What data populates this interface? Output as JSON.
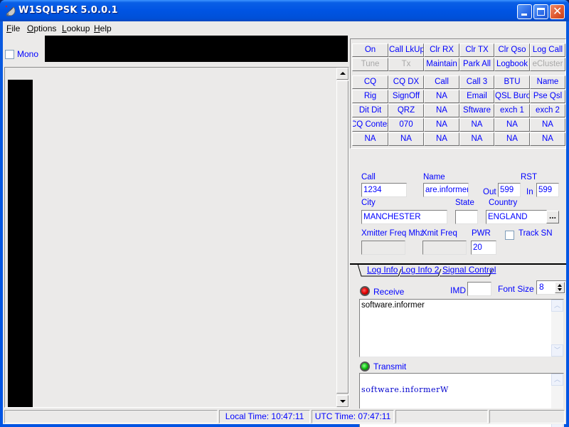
{
  "window": {
    "title": "W1SQLPSK 5.0.0.1",
    "app_icon": "satellite-dish-icon",
    "controls": {
      "minimize": "minimize-icon",
      "maximize": "maximize-icon",
      "close": "close-icon",
      "close_glyph": "✕"
    }
  },
  "menu": {
    "items": [
      {
        "label": "File",
        "accel": "F",
        "rest": "ile"
      },
      {
        "label": "Options",
        "accel": "O",
        "rest": "ptions"
      },
      {
        "label": "Lookup",
        "accel": "L",
        "rest": "ookup"
      },
      {
        "label": "Help",
        "accel": "H",
        "rest": "elp"
      }
    ]
  },
  "left": {
    "mono_label": "Mono",
    "mono_checked": false
  },
  "buttons": {
    "row1": [
      {
        "label": "On",
        "enabled": true
      },
      {
        "label": "Call LkUp",
        "enabled": true
      },
      {
        "label": "Clr RX",
        "enabled": true
      },
      {
        "label": "Clr TX",
        "enabled": true
      },
      {
        "label": "Clr Qso",
        "enabled": true
      },
      {
        "label": "Log Call",
        "enabled": true
      }
    ],
    "row2": [
      {
        "label": "Tune",
        "enabled": false
      },
      {
        "label": "Tx",
        "enabled": false
      },
      {
        "label": "Maintain",
        "enabled": true
      },
      {
        "label": "Park All",
        "enabled": true
      },
      {
        "label": "Logbook",
        "enabled": true
      },
      {
        "label": "eCluster",
        "enabled": false
      }
    ],
    "macros": [
      [
        "CQ",
        "CQ DX",
        "Call",
        "Call 3",
        "BTU",
        "Name"
      ],
      [
        "Rig",
        "SignOff",
        "NA",
        "Email",
        "QSL Buro",
        "Pse Qsl"
      ],
      [
        "Dit Dit",
        "QRZ",
        "NA",
        "Sftware",
        "exch 1",
        "exch 2"
      ],
      [
        "CQ Contes",
        "070",
        "NA",
        "NA",
        "NA",
        "NA"
      ],
      [
        "NA",
        "NA",
        "NA",
        "NA",
        "NA",
        "NA"
      ]
    ]
  },
  "form": {
    "call_label": "Call",
    "call_value": "1234",
    "name_label": "Name",
    "name_value": "are.informer",
    "rst_label": "RST",
    "out_label": "Out",
    "out_value": "599",
    "in_label": "In",
    "in_value": "599",
    "city_label": "City",
    "city_value": "MANCHESTER",
    "state_label": "State",
    "state_value": "",
    "country_label": "Country",
    "country_value": "ENGLAND",
    "country_browse": "...",
    "xmitter_label": "Xmitter Freq Mhz",
    "xmitter_value": "",
    "xmit_label": "Xmit Freq",
    "xmit_value": "",
    "pwr_label": "PWR",
    "pwr_value": "20",
    "track_label": "Track SN",
    "track_checked": false
  },
  "tabs": [
    {
      "label": "Log Info",
      "active": true
    },
    {
      "label": "Log Info 2",
      "active": false
    },
    {
      "label": "Signal Control",
      "active": false
    }
  ],
  "receive": {
    "label": "Receive",
    "led_color": "#e00000",
    "imd_label": "IMD",
    "imd_value": "",
    "font_size_label": "Font Size",
    "font_size_value": "8",
    "text": "software.informer"
  },
  "transmit": {
    "label": "Transmit",
    "led_color": "#10c010",
    "text": "software.informerW"
  },
  "status": {
    "panel1": "",
    "local_time": "Local Time: 10:47:11",
    "utc_time": "UTC Time: 07:47:11",
    "panel4": "",
    "panel5": ""
  }
}
